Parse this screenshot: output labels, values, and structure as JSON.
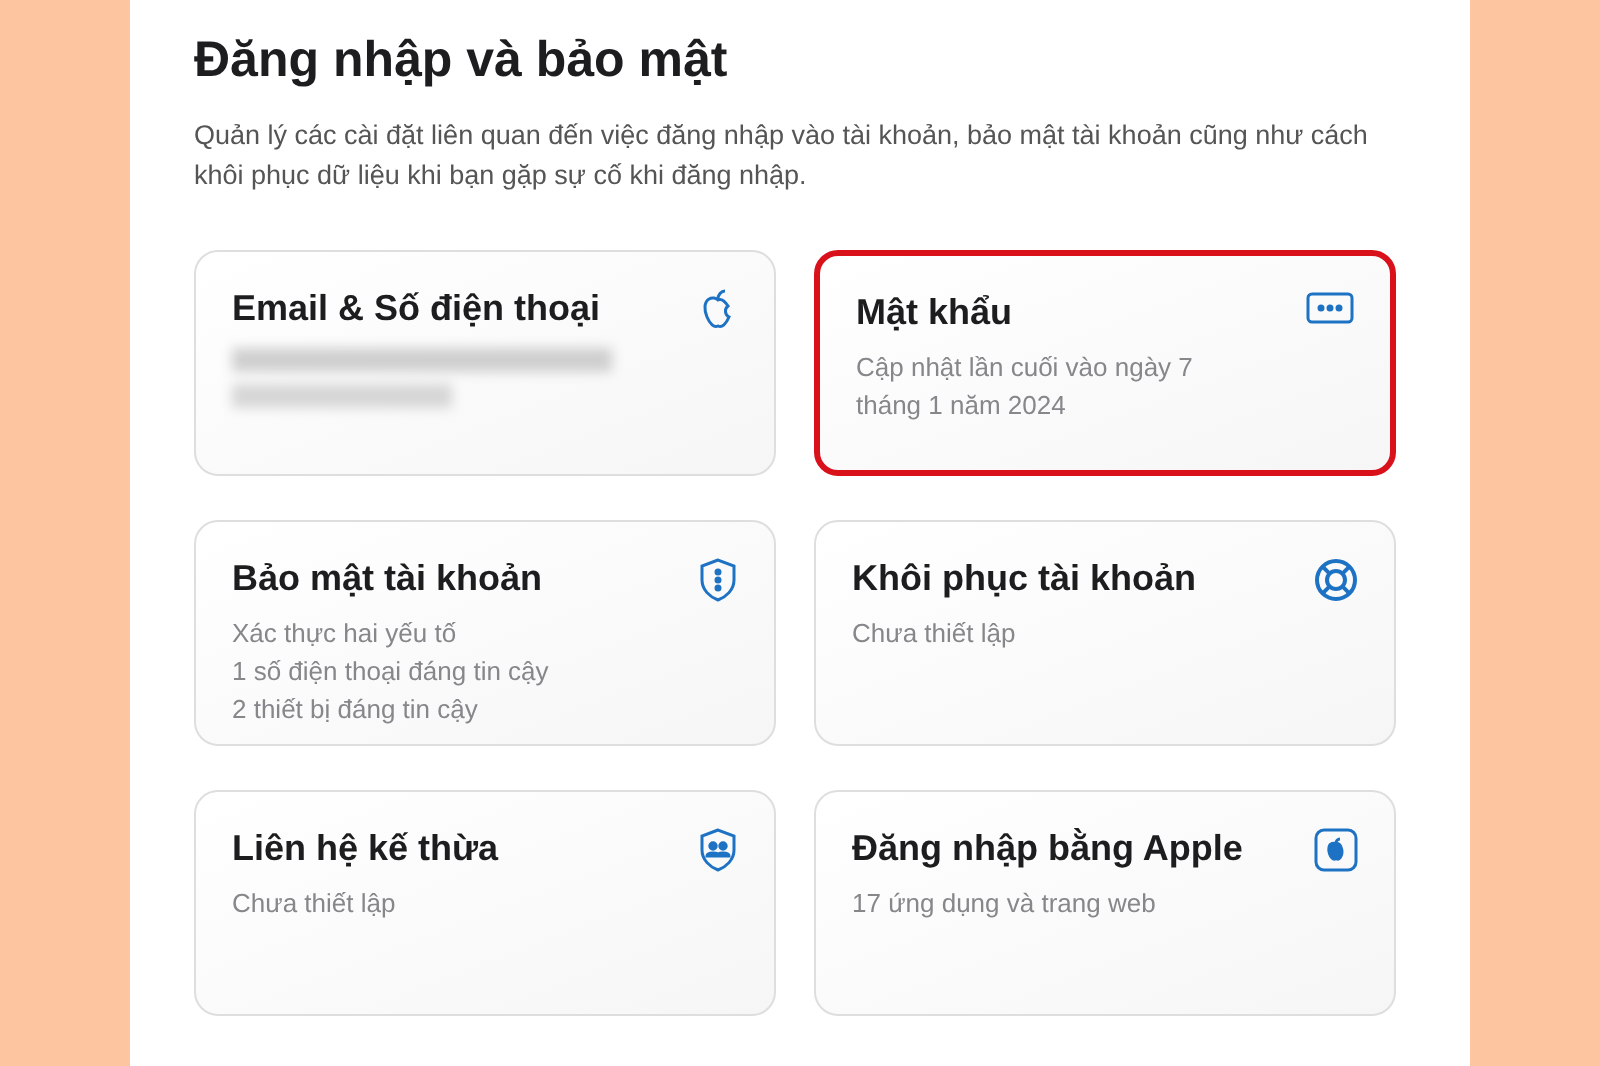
{
  "title": "Đăng nhập và bảo mật",
  "description": "Quản lý các cài đặt liên quan đến việc đăng nhập vào tài khoản, bảo mật tài khoản cũng như cách khôi phục dữ liệu khi bạn gặp sự cố khi đăng nhập.",
  "cards": [
    {
      "title": "Email & Số điện thoại",
      "redacted": true,
      "highlighted": false
    },
    {
      "title": "Mật khẩu",
      "lines": [
        "Cập nhật lần cuối vào ngày 7 tháng 1 năm 2024"
      ],
      "redacted": false,
      "highlighted": true
    },
    {
      "title": "Bảo mật tài khoản",
      "lines": [
        "Xác thực hai yếu tố",
        "1 số điện thoại đáng tin cậy",
        "2 thiết bị đáng tin cậy"
      ],
      "redacted": false,
      "highlighted": false
    },
    {
      "title": "Khôi phục tài khoản",
      "lines": [
        "Chưa thiết lập"
      ],
      "redacted": false,
      "highlighted": false
    },
    {
      "title": "Liên hệ kế thừa",
      "lines": [
        "Chưa thiết lập"
      ],
      "redacted": false,
      "highlighted": false
    },
    {
      "title": "Đăng nhập bằng Apple",
      "lines": [
        "17 ứng dụng và trang web"
      ],
      "redacted": false,
      "highlighted": false
    }
  ]
}
